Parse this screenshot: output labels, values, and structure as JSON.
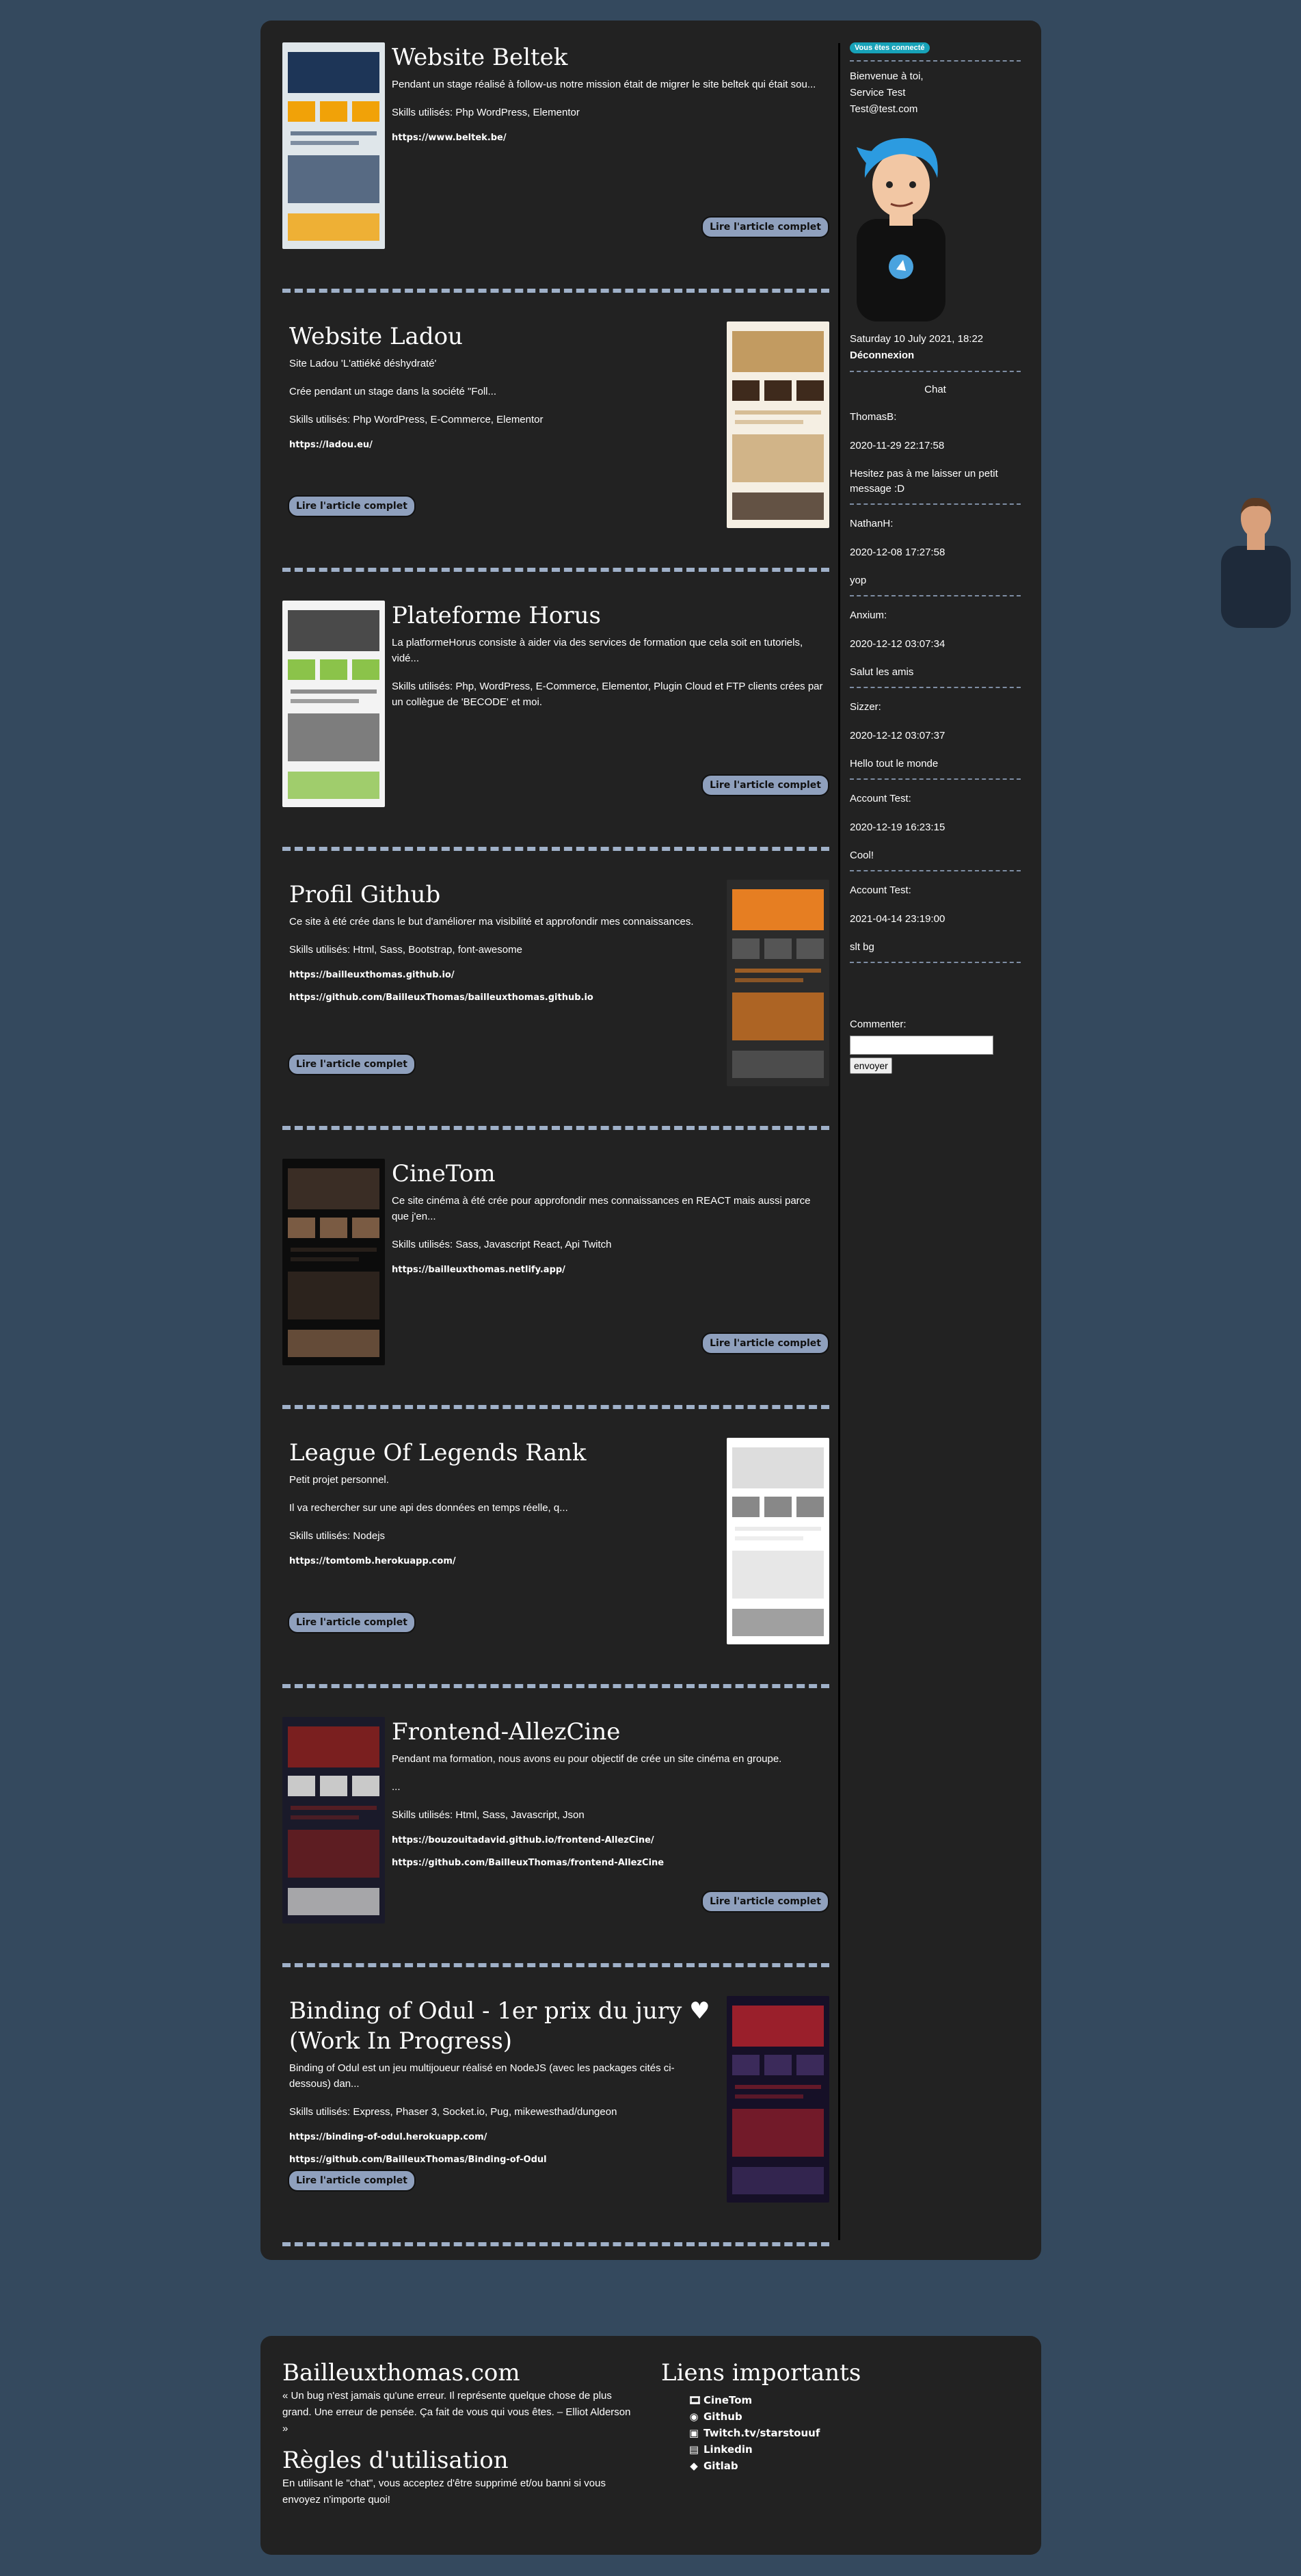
{
  "articles": [
    {
      "title": "Website Beltek",
      "paragraphs": [
        "Pendant un stage réalisé à follow-us notre mission était de migrer le site beltek qui était sou...",
        "Skills utilisés: Php WordPress, Elementor"
      ],
      "links": [
        "https://www.beltek.be/"
      ],
      "read_more": "Lire l'article complet"
    },
    {
      "title": "Website Ladou",
      "paragraphs": [
        "Site Ladou 'L'attiéké déshydraté'",
        "Crée pendant un stage dans la société \"Foll...",
        "Skills utilisés: Php WordPress, E-Commerce, Elementor"
      ],
      "links": [
        "https://ladou.eu/"
      ],
      "read_more": "Lire l'article complet"
    },
    {
      "title": "Plateforme Horus",
      "paragraphs": [
        "La platformeHorus consiste à aider via des services de formation que cela soit en tutoriels, vidé...",
        "Skills utilisés: Php, WordPress, E-Commerce, Elementor, Plugin Cloud et FTP clients crées par un collègue de 'BECODE' et moi."
      ],
      "links": [],
      "read_more": "Lire l'article complet"
    },
    {
      "title": "Profil Github",
      "paragraphs": [
        "Ce site à été crée dans le but d'améliorer ma visibilité et approfondir mes connaissances.",
        "Skills utilisés: Html, Sass, Bootstrap, font-awesome"
      ],
      "links": [
        "https://bailleuxthomas.github.io/",
        "https://github.com/BailleuxThomas/bailleuxthomas.github.io"
      ],
      "read_more": "Lire l'article complet"
    },
    {
      "title": "CineTom",
      "paragraphs": [
        "Ce site cinéma à été crée pour approfondir mes connaissances en REACT mais aussi parce que j'en...",
        "Skills utilisés: Sass, Javascript React, Api Twitch"
      ],
      "links": [
        "https://bailleuxthomas.netlify.app/"
      ],
      "read_more": "Lire l'article complet"
    },
    {
      "title": "League Of Legends Rank",
      "paragraphs": [
        "Petit projet personnel.",
        "Il va rechercher sur une api des données en temps réelle, q...",
        "Skills utilisés: Nodejs"
      ],
      "links": [
        "https://tomtomb.herokuapp.com/"
      ],
      "read_more": "Lire l'article complet"
    },
    {
      "title": "Frontend-AllezCine",
      "paragraphs": [
        "Pendant ma formation, nous avons eu pour objectif de crée un site cinéma en groupe.",
        "...",
        "Skills utilisés: Html, Sass, Javascript, Json"
      ],
      "links": [
        "https://bouzouitadavid.github.io/frontend-AllezCine/",
        "https://github.com/BailleuxThomas/frontend-AllezCine"
      ],
      "read_more": "Lire l'article complet"
    },
    {
      "title": "Binding of Odul - 1er prix du jury ♥ (Work In Progress)",
      "paragraphs": [
        "Binding of Odul est un jeu multijoueur réalisé en NodeJS (avec les packages cités ci-dessous) dan...",
        "Skills utilisés: Express, Phaser 3, Socket.io, Pug, mikewesthad/dungeon"
      ],
      "links": [
        "https://binding-of-odul.herokuapp.com/",
        "https://github.com/BailleuxThomas/Binding-of-Odul"
      ],
      "read_more": "Lire l'article complet"
    }
  ],
  "sidebar": {
    "badge": "Vous êtes connecté",
    "welcome": "Bienvenue à toi,",
    "name": "Service Test",
    "email": "Test@test.com",
    "datetime": "Saturday 10 July 2021, 18:22",
    "logout": "Déconnexion",
    "chat_title": "Chat",
    "messages": [
      {
        "user": "ThomasB:",
        "time": "2020-11-29 22:17:58",
        "text": "Hesitez pas à me laisser un petit message :D"
      },
      {
        "user": "NathanH:",
        "time": "2020-12-08 17:27:58",
        "text": "yop"
      },
      {
        "user": "Anxium:",
        "time": "2020-12-12 03:07:34",
        "text": "Salut les amis"
      },
      {
        "user": "Sizzer:",
        "time": "2020-12-12 03:07:37",
        "text": "Hello tout le monde"
      },
      {
        "user": "Account Test:",
        "time": "2020-12-19 16:23:15",
        "text": "Cool!"
      },
      {
        "user": "Account Test:",
        "time": "2021-04-14 23:19:00",
        "text": "slt bg"
      }
    ],
    "comment_label": "Commenter:",
    "send_label": "envoyer"
  },
  "footer": {
    "site_title": "Bailleuxthomas.com",
    "quote": "« Un bug n'est jamais qu'une erreur. Il représente quelque chose de plus grand. Une erreur de pensée. Ça fait de vous qui vous êtes. – Elliot Alderson »",
    "rules_title": "Règles d'utilisation",
    "rules_text": "En utilisant le \"chat\", vous acceptez d'être supprimé et/ou banni si vous envoyez n'importe quoi!",
    "links_title": "Liens importants",
    "links": [
      {
        "label": "CineTom",
        "icon": "film-icon"
      },
      {
        "label": "Github",
        "icon": "github-icon"
      },
      {
        "label": "Twitch.tv/starstouuf",
        "icon": "twitch-icon"
      },
      {
        "label": "Linkedin",
        "icon": "linkedin-icon"
      },
      {
        "label": "Gitlab",
        "icon": "gitlab-icon"
      }
    ]
  },
  "colors": {
    "page_bg": "#34495e",
    "panel_bg": "#222222",
    "button_bg": "#8fa0bd",
    "badge_bg": "#17a2b8",
    "separator": "#9fb0c8"
  }
}
